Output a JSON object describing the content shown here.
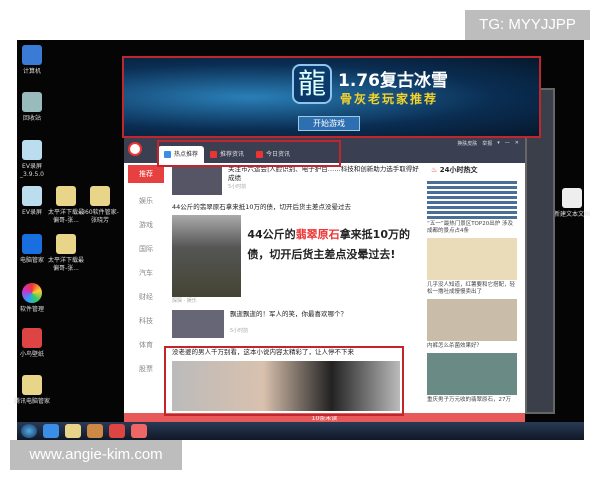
{
  "watermarks": {
    "top": "TG: MYYJJPP",
    "bottom": "www.angie-kim.com"
  },
  "desktop_icons": [
    {
      "label": "计算机",
      "icon": "computer-icon"
    },
    {
      "label": "回收站",
      "icon": "recycle-bin-icon"
    },
    {
      "label": "EV录屏_3.9.5.0",
      "icon": "ev-recorder-icon"
    },
    {
      "label": "EV录屏",
      "icon": "ev-recorder-icon"
    },
    {
      "label": "电脑管家",
      "icon": "pc-manager-icon"
    },
    {
      "label": "软件管理",
      "icon": "software-manager-icon"
    },
    {
      "label": "小鸟壁纸",
      "icon": "wallpaper-icon"
    },
    {
      "label": "腾讯电脑管家",
      "icon": "folder-icon"
    },
    {
      "label": "太平洋下载最偏哥-张...",
      "icon": "folder-icon"
    },
    {
      "label": "360软件管家-张晓芳",
      "icon": "folder-icon"
    },
    {
      "label": "太平洋下载最偏哥-张...",
      "icon": "folder-icon"
    },
    {
      "label": "新建文本文档",
      "icon": "text-file-icon"
    }
  ],
  "banner": {
    "logo": "龍",
    "title": "1.76复古冰雪",
    "subtitle": "骨灰老玩家推荐",
    "button": "开始游戏"
  },
  "window": {
    "tabs": [
      {
        "label": "热点推荐",
        "color": "#3b8ee6"
      },
      {
        "label": "推荐资讯",
        "color": "#e33"
      },
      {
        "label": "今日资讯",
        "color": "#e33"
      }
    ],
    "controls": [
      "换肤皮肤",
      "举报",
      "▾",
      "—",
      "✕"
    ],
    "nav": [
      "推荐",
      "娱乐",
      "游戏",
      "国际",
      "汽车",
      "财经",
      "科技",
      "体育",
      "股票"
    ],
    "articles": [
      {
        "title": "关注市六运会|人脸识别、电子护目……科技和创新助力选手取得好成绩",
        "time": "5小时前"
      },
      {
        "title": "44公斤的翡翠原石拿来抵10万的债，切开后货主差点没晕过去",
        "overlay_pre": "44公斤的",
        "overlay_hl": "翡翠原石",
        "overlay_post": "拿来抵10万的债，切开后货主差点没晕过去!",
        "source": "探探 · 娱乐"
      },
      {
        "title": "飘逝飘逝的！军人的笑，你最喜欢哪个？",
        "time": "5小时前"
      },
      {
        "title": "没老婆的男人千万别看，这本小说内容太精彩了，让人停不下来"
      }
    ],
    "right": {
      "header": "24小时热文",
      "items": [
        "“五一”最热门景区TOP20出炉 涉及成都的景点占4条",
        "几乎没人知道，红薯要和它搭配，轻松一撸吐成慢慢卖出了",
        "内裤怎么杀菌效果好？",
        "重庆男子万元收的翡翠原石，27万"
      ]
    },
    "bottom_bar": "10条未读"
  },
  "colors": {
    "accent": "#e74040",
    "highlight_border": "#c0262c"
  }
}
